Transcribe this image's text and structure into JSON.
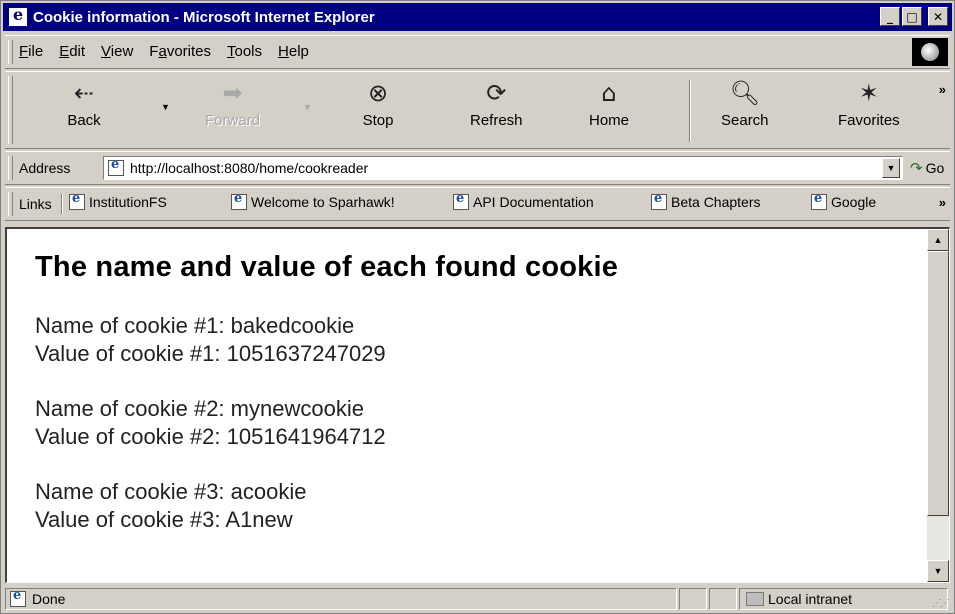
{
  "window": {
    "title": "Cookie information - Microsoft Internet Explorer",
    "controls": [
      "minimize",
      "maximize",
      "close"
    ]
  },
  "menu": {
    "items": [
      {
        "key": "F",
        "rest": "ile"
      },
      {
        "key": "E",
        "rest": "dit"
      },
      {
        "key": "V",
        "rest": "iew"
      },
      {
        "pre": "F",
        "key": "a",
        "rest": "vorites"
      },
      {
        "key": "T",
        "rest": "ools"
      },
      {
        "key": "H",
        "rest": "elp"
      }
    ]
  },
  "toolbar": {
    "back": "Back",
    "forward": "Forward",
    "stop": "Stop",
    "refresh": "Refresh",
    "home": "Home",
    "search": "Search",
    "favorites": "Favorites",
    "more": "»",
    "icons": {
      "back": "back-arrow-icon",
      "forward": "forward-arrow-icon",
      "stop": "stop-icon",
      "refresh": "refresh-icon",
      "home": "home-icon",
      "search": "search-icon",
      "favorites": "favorites-icon"
    }
  },
  "address": {
    "label": "Address",
    "url": "http://localhost:8080/home/cookreader",
    "go": "Go"
  },
  "links": {
    "label": "Links",
    "items": [
      "InstitutionFS",
      "Welcome to Sparhawk!",
      "API Documentation",
      "Beta Chapters",
      "Google"
    ],
    "more": "»"
  },
  "content": {
    "heading": "The name and value of each found cookie",
    "cookies": [
      {
        "name_line": "Name of cookie #1: bakedcookie",
        "value_line": "Value of cookie #1: 1051637247029"
      },
      {
        "name_line": "Name of cookie #2: mynewcookie",
        "value_line": "Value of cookie #2: 1051641964712"
      },
      {
        "name_line": "Name of cookie #3: acookie",
        "value_line": "Value of cookie #3: A1new"
      }
    ]
  },
  "status": {
    "text": "Done",
    "zone": "Local intranet"
  },
  "colors": {
    "titlebar": "#000080",
    "chrome": "#d4d0c8"
  }
}
